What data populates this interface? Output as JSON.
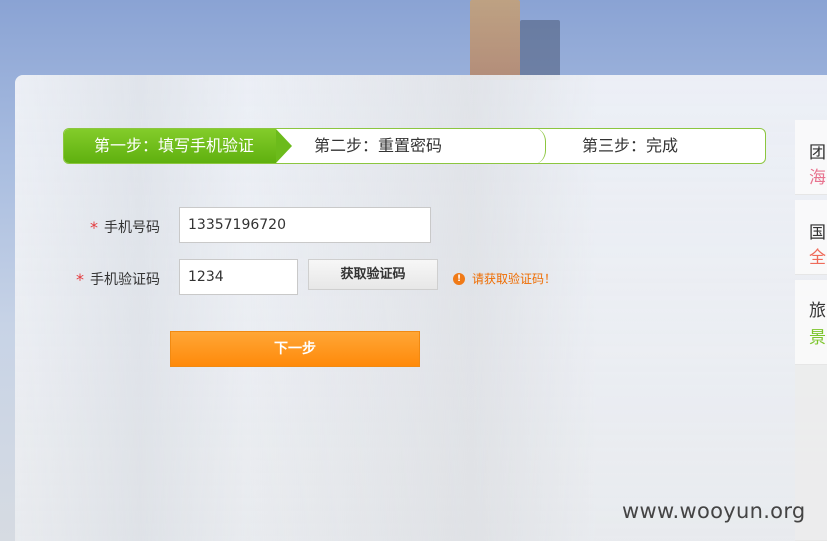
{
  "steps": {
    "step1": "第一步：填写手机验证",
    "step2": "第二步：重置密码",
    "step3": "第三步：完成"
  },
  "form": {
    "phone_label": "手机号码",
    "phone_value": "13357196720",
    "code_label": "手机验证码",
    "code_value": "1234",
    "get_code_button": "获取验证码",
    "hint_text": "请获取验证码！",
    "required_mark": "*",
    "next_button": "下一步"
  },
  "side_cards": [
    {
      "title": "团",
      "sub": "海",
      "sub_color": "#e8738f"
    },
    {
      "title": "国",
      "sub": "全",
      "sub_color": "#ef6b5a"
    },
    {
      "title": "旅",
      "sub": "景",
      "sub_color": "#7cc52b"
    }
  ],
  "watermark": "www.wooyun.org",
  "colors": {
    "step_active": "#6cbb1b",
    "next_button": "#ff8a0a",
    "hint": "#ef6c00",
    "required": "#e4393c"
  },
  "icons": {
    "warning": "warning-icon"
  }
}
